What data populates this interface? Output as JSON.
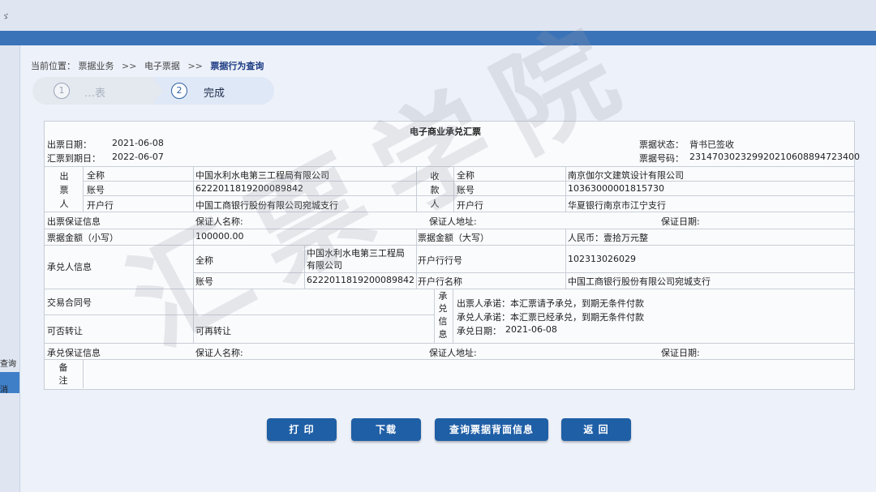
{
  "breadcrumb": {
    "prefix": "当前位置：",
    "items": [
      "票据业务",
      "电子票据",
      "票据行为查询"
    ],
    "separator": ">>"
  },
  "steps": [
    {
      "num": "1",
      "label": "…表"
    },
    {
      "num": "2",
      "label": "完成"
    }
  ],
  "sidebar": {
    "items": [
      "查询",
      "消"
    ]
  },
  "topbar": {
    "mark": "ゞ"
  },
  "bill": {
    "title": "电子商业承兑汇票",
    "issue_date_label": "出票日期：",
    "issue_date": "2021-06-08",
    "due_date_label": "汇票到期日：",
    "due_date": "2022-06-07",
    "status_label": "票据状态：",
    "status": "背书已签收",
    "number_label": "票据号码：",
    "number": "231470302329920210608894723400",
    "drawer": {
      "label_chars": [
        "出",
        "票",
        "人"
      ],
      "fullname_label": "全称",
      "fullname": "中国水利水电第三工程局有限公司",
      "account_label": "账号",
      "account": "622201181920008984​2",
      "bank_label": "开户行",
      "bank": "中国工商银行股份有限公司宛城支行"
    },
    "payee": {
      "label_chars": [
        "收",
        "款",
        "人"
      ],
      "fullname_label": "全称",
      "fullname": "南京伽尔文建筑设计有限公司",
      "account_label": "账号",
      "account": "10363000001815730",
      "bank_label": "开户行",
      "bank": "华夏银行南京市江宁支行"
    },
    "issue_guarantee": {
      "label": "出票保证信息",
      "guarantor_name_label": "保证人名称:",
      "guarantor_address_label": "保证人地址:",
      "guarantee_date_label": "保证日期:"
    },
    "amount_small_label": "票据金额（小写）",
    "amount_small": "100000.00",
    "amount_big_label": "票据金额（大写）",
    "amount_big": "人民币：壹拾万元整",
    "acceptor": {
      "label": "承兑人信息",
      "fullname_label": "全称",
      "fullname_line1": "中国水利水电第三工程局",
      "fullname_line2": "有限公司",
      "account_label": "账号",
      "account": "6222011819200089842",
      "bank_no_label": "开户行行号",
      "bank_no": "102313026029",
      "bank_name_label": "开户行名称",
      "bank_name": "中国工商银行股份有限公司宛城支行"
    },
    "contract_label": "交易合同号",
    "contract_value": "",
    "transferable_label": "可否转让",
    "transferable": "可再转让",
    "acceptance": {
      "label_chars": [
        "承",
        "兑",
        "信",
        "息"
      ],
      "drawer_promise": "出票人承诺：本汇票请予承兑，到期无条件付款",
      "acceptor_promise": "承兑人承诺：本汇票已经承兑，到期无条件付款",
      "date_label": "承兑日期：",
      "date": "2021-06-08"
    },
    "accept_guarantee": {
      "label": "承兑保证信息",
      "guarantor_name_label": "保证人名称:",
      "guarantor_address_label": "保证人地址:",
      "guarantee_date_label": "保证日期:"
    },
    "remark_chars": [
      "备",
      "注"
    ]
  },
  "buttons": {
    "print": "打 印",
    "download": "下载",
    "query_back": "查询票据背面信息",
    "back": "返 回"
  },
  "watermark": "汇票学院"
}
